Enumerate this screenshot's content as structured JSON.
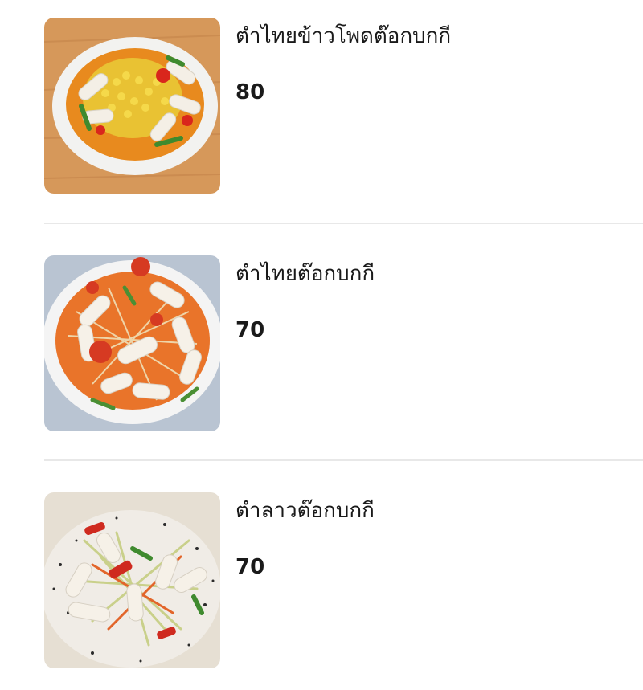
{
  "menu": {
    "items": [
      {
        "name": "ตำไทยข้าวโพดต๊อกบกกี",
        "price": "80",
        "image": "corn-tteokbokki-papaya-salad-photo"
      },
      {
        "name": "ตำไทยต๊อกบกกี",
        "price": "70",
        "image": "thai-tteokbokki-papaya-salad-photo"
      },
      {
        "name": "ตำลาวต๊อกบกกี",
        "price": "70",
        "image": "lao-tteokbokki-papaya-salad-photo"
      }
    ]
  }
}
